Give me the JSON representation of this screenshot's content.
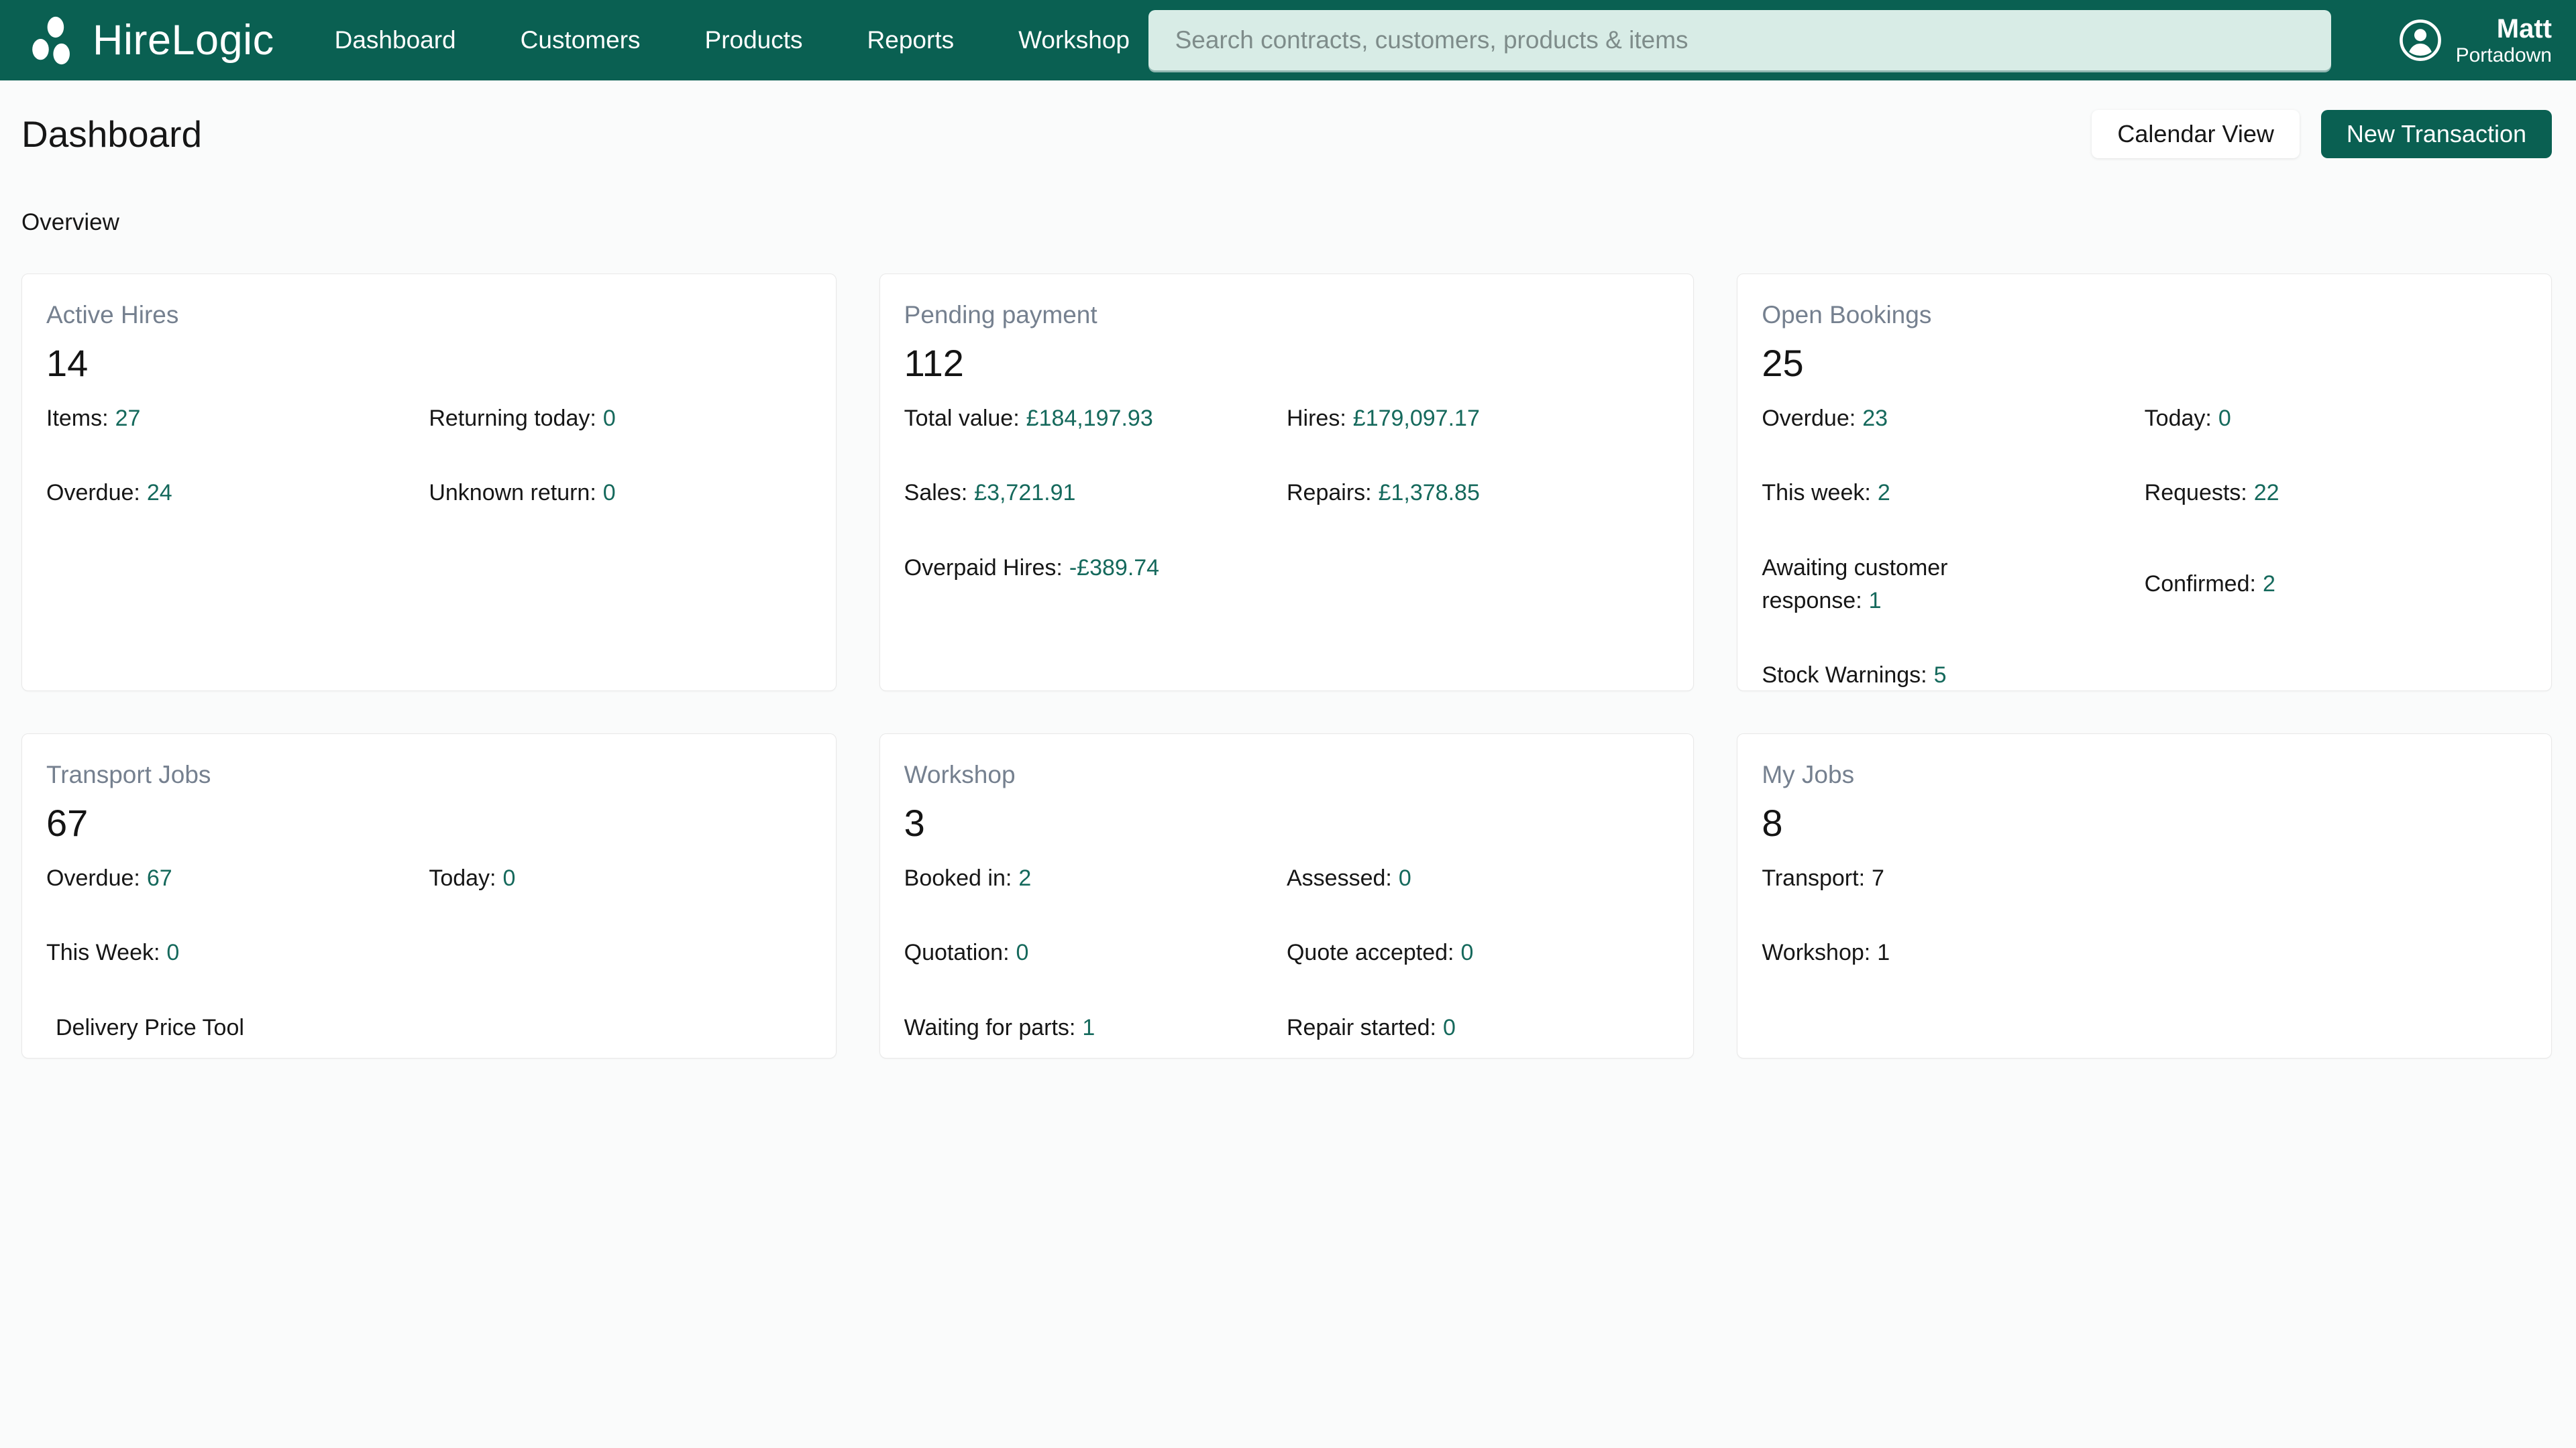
{
  "brand": {
    "name": "HireLogic"
  },
  "nav": {
    "items": [
      {
        "label": "Dashboard"
      },
      {
        "label": "Customers"
      },
      {
        "label": "Products"
      },
      {
        "label": "Reports"
      },
      {
        "label": "Workshop"
      }
    ]
  },
  "search": {
    "placeholder": "Search contracts, customers, products & items",
    "value": ""
  },
  "user": {
    "name": "Matt",
    "location": "Portadown"
  },
  "page": {
    "title": "Dashboard",
    "overview_label": "Overview",
    "buttons": {
      "calendar_view": "Calendar View",
      "new_transaction": "New Transaction"
    }
  },
  "colors": {
    "brand_green": "#0A6052",
    "accent_teal": "#15695C",
    "card_title_gray": "#75808F",
    "search_bg": "#D8ECE6",
    "page_bg": "#FAFBFB"
  },
  "cards": [
    {
      "title": "Active Hires",
      "count": "14",
      "stats": [
        {
          "label": "Items:",
          "value": "27"
        },
        {
          "label": "Returning today:",
          "value": "0"
        },
        {
          "label": "Overdue:",
          "value": "24"
        },
        {
          "label": "Unknown return:",
          "value": "0"
        }
      ]
    },
    {
      "title": "Pending payment",
      "count": "112",
      "stats": [
        {
          "label": "Total value:",
          "value": "£184,197.93"
        },
        {
          "label": "Hires:",
          "value": "£179,097.17"
        },
        {
          "label": "Sales:",
          "value": "£3,721.91"
        },
        {
          "label": "Repairs:",
          "value": "£1,378.85"
        },
        {
          "label": "Overpaid Hires:",
          "value": "-£389.74"
        }
      ]
    },
    {
      "title": "Open Bookings",
      "count": "25",
      "stats": [
        {
          "label": "Overdue:",
          "value": "23"
        },
        {
          "label": "Today:",
          "value": "0"
        },
        {
          "label": "This week:",
          "value": "2"
        },
        {
          "label": "Requests:",
          "value": "22"
        },
        {
          "label": "Awaiting customer response:",
          "value": "1"
        },
        {
          "label": "Confirmed:",
          "value": "2"
        },
        {
          "label": "Stock Warnings:",
          "value": "5"
        }
      ]
    },
    {
      "title": "Transport Jobs",
      "count": "67",
      "stats": [
        {
          "label": "Overdue:",
          "value": "67"
        },
        {
          "label": "Today:",
          "value": "0"
        },
        {
          "label": "This Week:",
          "value": "0"
        }
      ],
      "link_label": "Delivery Price Tool"
    },
    {
      "title": "Workshop",
      "count": "3",
      "stats": [
        {
          "label": "Booked in:",
          "value": "2"
        },
        {
          "label": "Assessed:",
          "value": "0"
        },
        {
          "label": "Quotation:",
          "value": "0"
        },
        {
          "label": "Quote accepted:",
          "value": "0"
        },
        {
          "label": "Waiting for parts:",
          "value": "1"
        },
        {
          "label": "Repair started:",
          "value": "0"
        }
      ]
    },
    {
      "title": "My Jobs",
      "count": "8",
      "stats": [
        {
          "label": "Transport:",
          "value": "7"
        },
        {
          "label": "Workshop:",
          "value": "1"
        }
      ]
    }
  ]
}
